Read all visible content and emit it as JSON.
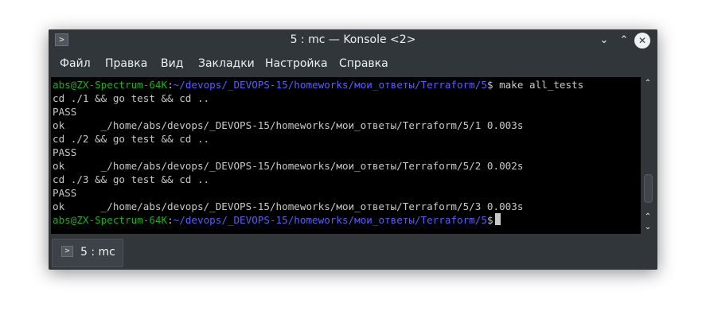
{
  "window": {
    "title": "5 : mc — Konsole <2>"
  },
  "menu": [
    "Файл",
    "Правка",
    "Вид",
    "Закладки",
    "Настройка",
    "Справка"
  ],
  "terminal": {
    "lines": [
      {
        "user": "abs@ZX-Spectrum-64K",
        "sep": ":",
        "path": "~/devops/_DEVOPS-15/homeworks/мои_ответы/Terraform/5",
        "cmd": "$ make all_tests"
      },
      {
        "text": "cd ./1 && go test && cd .."
      },
      {
        "text": "PASS"
      },
      {
        "text": "ok      _/home/abs/devops/_DEVOPS-15/homeworks/мои_ответы/Terraform/5/1 0.003s"
      },
      {
        "text": "cd ./2 && go test && cd .."
      },
      {
        "text": "PASS"
      },
      {
        "text": "ok      _/home/abs/devops/_DEVOPS-15/homeworks/мои_ответы/Terraform/5/2 0.002s"
      },
      {
        "text": "cd ./3 && go test && cd .."
      },
      {
        "text": "PASS"
      },
      {
        "text": "ok      _/home/abs/devops/_DEVOPS-15/homeworks/мои_ответы/Terraform/5/3 0.003s"
      },
      {
        "user": "abs@ZX-Spectrum-64K",
        "sep": ":",
        "path": "~/devops/_DEVOPS-15/homeworks/мои_ответы/Terraform/5",
        "cmd": "$"
      }
    ]
  },
  "tabs": [
    {
      "label": "5 : mc"
    }
  ],
  "icons": {
    "app": "terminal-icon",
    "minimize": "chevron-down-icon",
    "maximize": "chevron-up-icon",
    "close": "close-icon"
  },
  "colors": {
    "chrome": "#31363b",
    "terminal_bg": "#000000",
    "prompt_user": "#18b218",
    "prompt_path": "#5c5cff",
    "terminal_text": "#c8c8c8"
  }
}
